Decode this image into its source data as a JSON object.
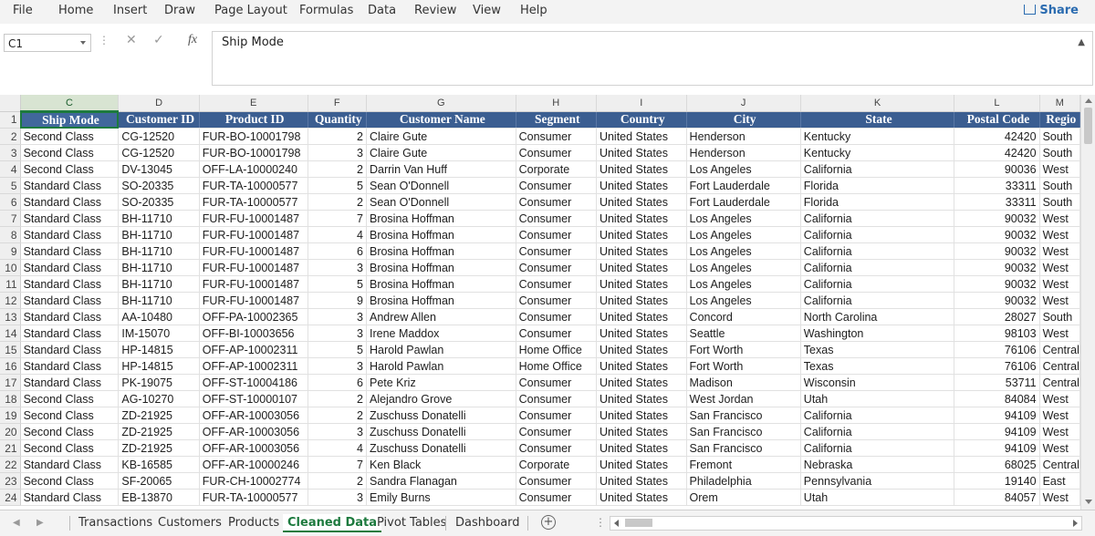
{
  "menu": [
    "File",
    "Home",
    "Insert",
    "Draw",
    "Page Layout",
    "Formulas",
    "Data",
    "Review",
    "View",
    "Help"
  ],
  "share_label": "Share",
  "namebox": "C1",
  "fx_label": "fx",
  "formula": "Ship Mode",
  "columns": [
    "C",
    "D",
    "E",
    "F",
    "G",
    "H",
    "I",
    "J",
    "K",
    "L",
    "M"
  ],
  "headers": [
    "Ship Mode",
    "Customer ID",
    "Product ID",
    "Quantity",
    "Customer Name",
    "Segment",
    "Country",
    "City",
    "State",
    "Postal Code",
    "Regio"
  ],
  "rows": [
    [
      "Second Class",
      "CG-12520",
      "FUR-BO-10001798",
      "2",
      "Claire Gute",
      "Consumer",
      "United States",
      "Henderson",
      "Kentucky",
      "42420",
      "South"
    ],
    [
      "Second Class",
      "CG-12520",
      "FUR-BO-10001798",
      "3",
      "Claire Gute",
      "Consumer",
      "United States",
      "Henderson",
      "Kentucky",
      "42420",
      "South"
    ],
    [
      "Second Class",
      "DV-13045",
      "OFF-LA-10000240",
      "2",
      "Darrin Van Huff",
      "Corporate",
      "United States",
      "Los Angeles",
      "California",
      "90036",
      "West"
    ],
    [
      "Standard Class",
      "SO-20335",
      "FUR-TA-10000577",
      "5",
      "Sean O'Donnell",
      "Consumer",
      "United States",
      "Fort Lauderdale",
      "Florida",
      "33311",
      "South"
    ],
    [
      "Standard Class",
      "SO-20335",
      "FUR-TA-10000577",
      "2",
      "Sean O'Donnell",
      "Consumer",
      "United States",
      "Fort Lauderdale",
      "Florida",
      "33311",
      "South"
    ],
    [
      "Standard Class",
      "BH-11710",
      "FUR-FU-10001487",
      "7",
      "Brosina Hoffman",
      "Consumer",
      "United States",
      "Los Angeles",
      "California",
      "90032",
      "West"
    ],
    [
      "Standard Class",
      "BH-11710",
      "FUR-FU-10001487",
      "4",
      "Brosina Hoffman",
      "Consumer",
      "United States",
      "Los Angeles",
      "California",
      "90032",
      "West"
    ],
    [
      "Standard Class",
      "BH-11710",
      "FUR-FU-10001487",
      "6",
      "Brosina Hoffman",
      "Consumer",
      "United States",
      "Los Angeles",
      "California",
      "90032",
      "West"
    ],
    [
      "Standard Class",
      "BH-11710",
      "FUR-FU-10001487",
      "3",
      "Brosina Hoffman",
      "Consumer",
      "United States",
      "Los Angeles",
      "California",
      "90032",
      "West"
    ],
    [
      "Standard Class",
      "BH-11710",
      "FUR-FU-10001487",
      "5",
      "Brosina Hoffman",
      "Consumer",
      "United States",
      "Los Angeles",
      "California",
      "90032",
      "West"
    ],
    [
      "Standard Class",
      "BH-11710",
      "FUR-FU-10001487",
      "9",
      "Brosina Hoffman",
      "Consumer",
      "United States",
      "Los Angeles",
      "California",
      "90032",
      "West"
    ],
    [
      "Standard Class",
      "AA-10480",
      "OFF-PA-10002365",
      "3",
      "Andrew Allen",
      "Consumer",
      "United States",
      "Concord",
      "North Carolina",
      "28027",
      "South"
    ],
    [
      "Standard Class",
      "IM-15070",
      "OFF-BI-10003656",
      "3",
      "Irene Maddox",
      "Consumer",
      "United States",
      "Seattle",
      "Washington",
      "98103",
      "West"
    ],
    [
      "Standard Class",
      "HP-14815",
      "OFF-AP-10002311",
      "5",
      "Harold Pawlan",
      "Home Office",
      "United States",
      "Fort Worth",
      "Texas",
      "76106",
      "Central"
    ],
    [
      "Standard Class",
      "HP-14815",
      "OFF-AP-10002311",
      "3",
      "Harold Pawlan",
      "Home Office",
      "United States",
      "Fort Worth",
      "Texas",
      "76106",
      "Central"
    ],
    [
      "Standard Class",
      "PK-19075",
      "OFF-ST-10004186",
      "6",
      "Pete Kriz",
      "Consumer",
      "United States",
      "Madison",
      "Wisconsin",
      "53711",
      "Central"
    ],
    [
      "Second Class",
      "AG-10270",
      "OFF-ST-10000107",
      "2",
      "Alejandro Grove",
      "Consumer",
      "United States",
      "West Jordan",
      "Utah",
      "84084",
      "West"
    ],
    [
      "Second Class",
      "ZD-21925",
      "OFF-AR-10003056",
      "2",
      "Zuschuss Donatelli",
      "Consumer",
      "United States",
      "San Francisco",
      "California",
      "94109",
      "West"
    ],
    [
      "Second Class",
      "ZD-21925",
      "OFF-AR-10003056",
      "3",
      "Zuschuss Donatelli",
      "Consumer",
      "United States",
      "San Francisco",
      "California",
      "94109",
      "West"
    ],
    [
      "Second Class",
      "ZD-21925",
      "OFF-AR-10003056",
      "4",
      "Zuschuss Donatelli",
      "Consumer",
      "United States",
      "San Francisco",
      "California",
      "94109",
      "West"
    ],
    [
      "Standard Class",
      "KB-16585",
      "OFF-AR-10000246",
      "7",
      "Ken Black",
      "Corporate",
      "United States",
      "Fremont",
      "Nebraska",
      "68025",
      "Central"
    ],
    [
      "Second Class",
      "SF-20065",
      "FUR-CH-10002774",
      "2",
      "Sandra Flanagan",
      "Consumer",
      "United States",
      "Philadelphia",
      "Pennsylvania",
      "19140",
      "East"
    ],
    [
      "Standard Class",
      "EB-13870",
      "FUR-TA-10000577",
      "3",
      "Emily Burns",
      "Consumer",
      "United States",
      "Orem",
      "Utah",
      "84057",
      "West"
    ]
  ],
  "sheet_tabs": [
    "Transactions",
    "Customers",
    "Products",
    "Cleaned Data",
    "Pivot Tables",
    "Dashboard"
  ],
  "active_tab": "Cleaned Data",
  "accent_color": "#1d7a3e",
  "header_fill": "#3b5e91"
}
